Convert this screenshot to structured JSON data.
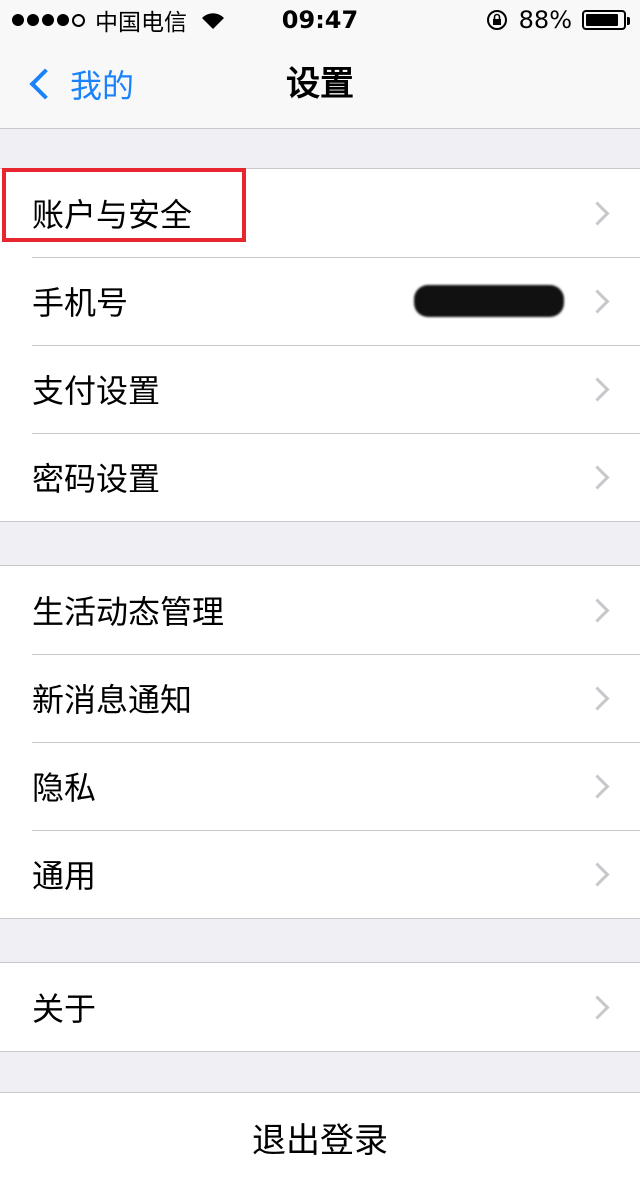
{
  "status_bar": {
    "carrier": "中国电信",
    "time": "09:47",
    "battery": "88%",
    "battery_level": 0.88,
    "icons": [
      "signal-dots-icon",
      "wifi-icon",
      "rotation-lock-icon",
      "battery-icon"
    ]
  },
  "nav": {
    "back_label": "我的",
    "title": "设置"
  },
  "groups": [
    {
      "items": [
        {
          "label": "账户与安全"
        },
        {
          "label": "手机号",
          "value_redacted": true
        },
        {
          "label": "支付设置"
        },
        {
          "label": "密码设置"
        }
      ]
    },
    {
      "items": [
        {
          "label": "生活动态管理"
        },
        {
          "label": "新消息通知"
        },
        {
          "label": "隐私"
        },
        {
          "label": "通用"
        }
      ]
    },
    {
      "items": [
        {
          "label": "关于"
        }
      ]
    }
  ],
  "logout_label": "退出登录",
  "colors": {
    "accent": "#1a82fb",
    "highlight": "#e8262f",
    "background": "#efeff4"
  }
}
